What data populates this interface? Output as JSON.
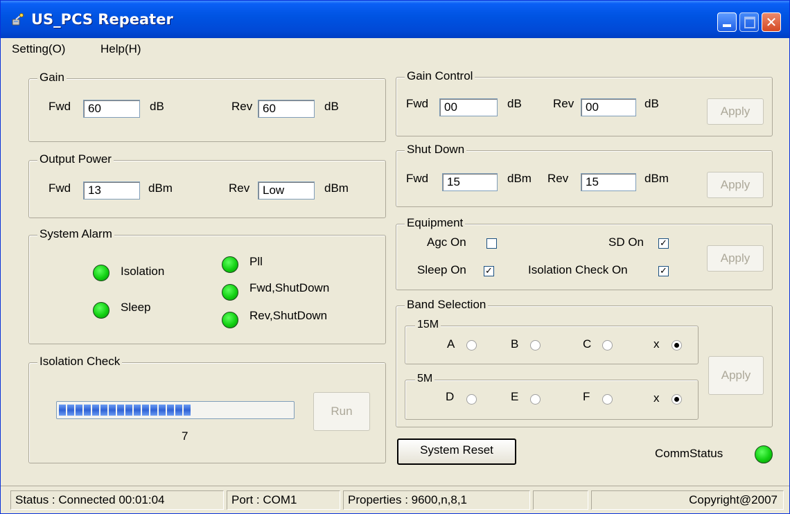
{
  "window": {
    "title": "US_PCS Repeater",
    "accent_color": "#0054e3",
    "title_icon": "satellite-icon"
  },
  "menu": [
    {
      "label": "Setting(O)"
    },
    {
      "label": "Help(H)"
    }
  ],
  "gain": {
    "legend": "Gain",
    "fwd_label": "Fwd",
    "fwd_value": "60",
    "fwd_unit": "dB",
    "rev_label": "Rev",
    "rev_value": "60",
    "rev_unit": "dB"
  },
  "output_power": {
    "legend": "Output Power",
    "fwd_label": "Fwd",
    "fwd_value": "13",
    "fwd_unit": "dBm",
    "rev_label": "Rev",
    "rev_value": "Low",
    "rev_unit": "dBm"
  },
  "system_alarm": {
    "legend": "System Alarm",
    "items": [
      {
        "label": "Isolation",
        "color": "#12d012"
      },
      {
        "label": "Sleep",
        "color": "#12d012"
      },
      {
        "label": "Pll",
        "color": "#12d012"
      },
      {
        "label": "Fwd,ShutDown",
        "color": "#12d012"
      },
      {
        "label": "Rev,ShutDown",
        "color": "#12d012"
      }
    ]
  },
  "isolation_check": {
    "legend": "Isolation Check",
    "progress_value": "7",
    "progress_fraction": 0.57,
    "run_label": "Run"
  },
  "gain_control": {
    "legend": "Gain Control",
    "fwd_label": "Fwd",
    "fwd_value": "00",
    "fwd_unit": "dB",
    "rev_label": "Rev",
    "rev_value": "00",
    "rev_unit": "dB",
    "apply_label": "Apply"
  },
  "shut_down": {
    "legend": "Shut Down",
    "fwd_label": "Fwd",
    "fwd_value": "15",
    "fwd_unit": "dBm",
    "rev_label": "Rev",
    "rev_value": "15",
    "rev_unit": "dBm",
    "apply_label": "Apply"
  },
  "equipment": {
    "legend": "Equipment",
    "agc_label": "Agc On",
    "agc_checked": false,
    "sd_label": "SD On",
    "sd_checked": true,
    "sleep_label": "Sleep On",
    "sleep_checked": true,
    "iso_label": "Isolation Check On",
    "iso_checked": true,
    "apply_label": "Apply"
  },
  "band_selection": {
    "legend": "Band Selection",
    "group_15m": {
      "legend": "15M",
      "options": [
        {
          "label": "A",
          "selected": false
        },
        {
          "label": "B",
          "selected": false
        },
        {
          "label": "C",
          "selected": false
        },
        {
          "label": "x",
          "selected": true
        }
      ]
    },
    "group_5m": {
      "legend": "5M",
      "options": [
        {
          "label": "D",
          "selected": false
        },
        {
          "label": "E",
          "selected": false
        },
        {
          "label": "F",
          "selected": false
        },
        {
          "label": "x",
          "selected": true
        }
      ]
    },
    "apply_label": "Apply"
  },
  "system_reset_label": "System Reset",
  "comm_status": {
    "label": "CommStatus",
    "color": "#12d012"
  },
  "statusbar": {
    "status": "Status : Connected 00:01:04",
    "port": "Port : COM1",
    "properties": "Properties : 9600,n,8,1",
    "empty": "",
    "copyright": "Copyright@2007"
  }
}
